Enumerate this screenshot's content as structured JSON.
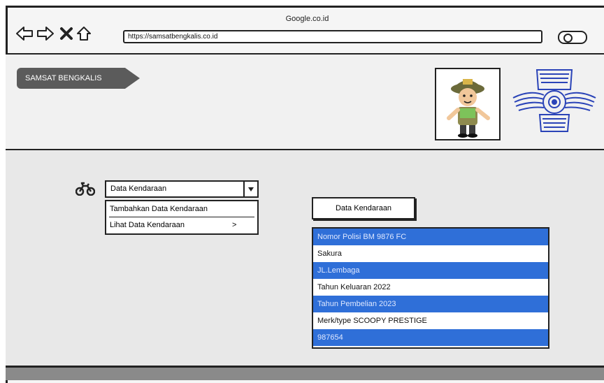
{
  "browser": {
    "title": "Google.co.id",
    "url": "https://samsatbengkalis.co.id"
  },
  "header": {
    "brand": "SAMSAT BENGKALIS"
  },
  "menu": {
    "dropdown_value": "Data Kendaraan",
    "items": [
      {
        "label": "Tambahkan Data Kendaraan"
      },
      {
        "label": "Lihat Data Kendaraan"
      }
    ],
    "caret": ">"
  },
  "panel": {
    "button_label": "Data Kendaraan",
    "rows": [
      {
        "text": "Nomor Polisi BM 9876 FC"
      },
      {
        "text": "Sakura"
      },
      {
        "text": "JL.Lembaga"
      },
      {
        "text": "Tahun Keluaran 2022"
      },
      {
        "text": "Tahun Pembelian 2023"
      },
      {
        "text": "Merk/type SCOOPY PRESTIGE"
      },
      {
        "text": "987654"
      }
    ]
  },
  "colors": {
    "selected_row": "#2f6fd8",
    "brand_bg": "#5b5b5b"
  }
}
